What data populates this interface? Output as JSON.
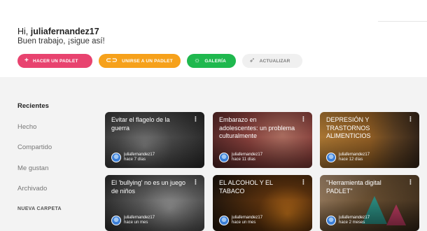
{
  "greeting": {
    "prefix": "Hi, ",
    "username": "juliafernandez17",
    "subtitle": "Buen trabajo, ¡sigue así!"
  },
  "actions": {
    "create": {
      "icon": "plus-icon",
      "label": "HACER UN PADLET",
      "color": "#e8436f"
    },
    "join": {
      "icon": "link-icon",
      "label": "UNIRSE A UN PADLET",
      "color": "#f6a11b"
    },
    "gallery": {
      "icon": "lightbulb-icon",
      "label": "GALERÍA",
      "color": "#1fb84e"
    },
    "upgrade": {
      "icon": "rocket-icon",
      "label": "ACTUALIZAR",
      "color": "#f0f0f0"
    }
  },
  "sidebar": {
    "items": [
      {
        "label": "Recientes",
        "active": true
      },
      {
        "label": "Hecho"
      },
      {
        "label": "Compartido"
      },
      {
        "label": "Me gustan"
      },
      {
        "label": "Archivado"
      }
    ],
    "new_folder": "NUEVA CARPETA"
  },
  "padlets": [
    {
      "title": "Evitar el flagelo de la guerra",
      "author": "juliafernandez17",
      "time": "hace 7 días"
    },
    {
      "title": "Embarazo en adolescentes: un problema culturalmente",
      "author": "juliafernandez17",
      "time": "hace 11 días"
    },
    {
      "title": "DEPRESIÓN Y TRASTORNOS ALIMENTICIOS",
      "author": "juliafernandez17",
      "time": "hace 12 días"
    },
    {
      "title": "El 'bullying' no es un juego de niños",
      "author": "juliafernandez17",
      "time": "hace un mes"
    },
    {
      "title": "EL ALCOHOL Y EL TABACO",
      "author": "juliafernandez17",
      "time": "hace un mes"
    },
    {
      "title": "\"Herramienta digital PADLET\"",
      "author": "juliafernandez17",
      "time": "hace 2 meses"
    }
  ]
}
